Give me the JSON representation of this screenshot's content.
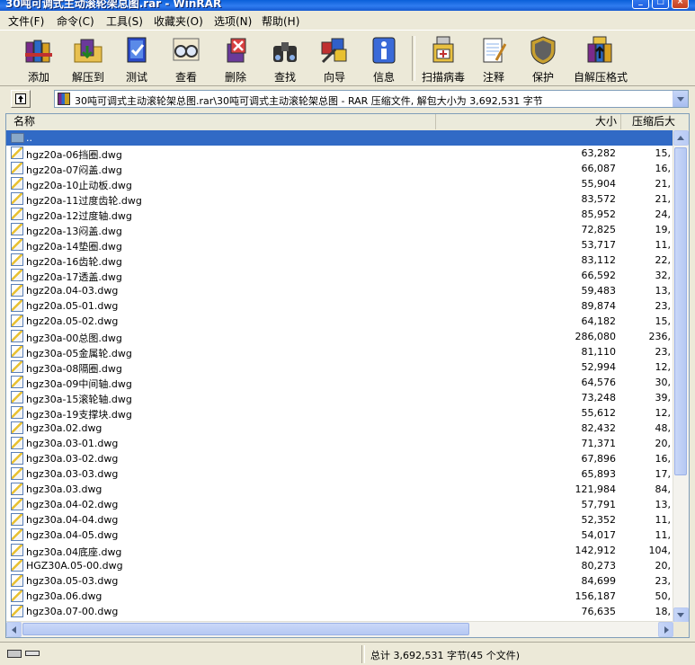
{
  "window": {
    "title": "30吨可调式主动滚轮架总图.rar - WinRAR",
    "minimize_glyph": "_",
    "maximize_glyph": "□",
    "close_glyph": "×"
  },
  "menu": [
    {
      "label": "文件(F)"
    },
    {
      "label": "命令(C)"
    },
    {
      "label": "工具(S)"
    },
    {
      "label": "收藏夹(O)"
    },
    {
      "label": "选项(N)"
    },
    {
      "label": "帮助(H)"
    }
  ],
  "toolbar": [
    {
      "label": "添加",
      "icon": "books-add-icon"
    },
    {
      "label": "解压到",
      "icon": "folder-extract-icon"
    },
    {
      "label": "测试",
      "icon": "book-test-icon"
    },
    {
      "label": "查看",
      "icon": "glasses-view-icon"
    },
    {
      "label": "删除",
      "icon": "book-delete-icon"
    },
    {
      "label": "查找",
      "icon": "binoculars-find-icon"
    },
    {
      "label": "向导",
      "icon": "wand-wizard-icon"
    },
    {
      "label": "信息",
      "icon": "info-icon"
    },
    {
      "label": "扫描病毒",
      "icon": "virus-scan-icon"
    },
    {
      "label": "注释",
      "icon": "notepad-comment-icon"
    },
    {
      "label": "保护",
      "icon": "shield-protect-icon"
    },
    {
      "label": "自解压格式",
      "icon": "sfx-icon"
    }
  ],
  "address": {
    "path": "30吨可调式主动滚轮架总图.rar\\30吨可调式主动滚轮架总图 - RAR 压缩文件, 解包大小为 3,692,531 字节"
  },
  "columns": {
    "name": "名称",
    "size": "大小",
    "packed": "压缩后大"
  },
  "files": [
    {
      "name": "..",
      "size": "",
      "packed": "",
      "folder": true
    },
    {
      "name": "hgz20a-06挡圈.dwg",
      "size": "63,282",
      "packed": "15,"
    },
    {
      "name": "hgz20a-07闷盖.dwg",
      "size": "66,087",
      "packed": "16,"
    },
    {
      "name": "hgz20a-10止动板.dwg",
      "size": "55,904",
      "packed": "21,"
    },
    {
      "name": "hgz20a-11过度齿轮.dwg",
      "size": "83,572",
      "packed": "21,"
    },
    {
      "name": "hgz20a-12过度轴.dwg",
      "size": "85,952",
      "packed": "24,"
    },
    {
      "name": "hgz20a-13闷盖.dwg",
      "size": "72,825",
      "packed": "19,"
    },
    {
      "name": "hgz20a-14垫圈.dwg",
      "size": "53,717",
      "packed": "11,"
    },
    {
      "name": "hgz20a-16齿轮.dwg",
      "size": "83,112",
      "packed": "22,"
    },
    {
      "name": "hgz20a-17透盖.dwg",
      "size": "66,592",
      "packed": "32,"
    },
    {
      "name": "hgz20a.04-03.dwg",
      "size": "59,483",
      "packed": "13,"
    },
    {
      "name": "hgz20a.05-01.dwg",
      "size": "89,874",
      "packed": "23,"
    },
    {
      "name": "hgz20a.05-02.dwg",
      "size": "64,182",
      "packed": "15,"
    },
    {
      "name": "hgz30a-00总图.dwg",
      "size": "286,080",
      "packed": "236,"
    },
    {
      "name": "hgz30a-05金属轮.dwg",
      "size": "81,110",
      "packed": "23,"
    },
    {
      "name": "hgz30a-08隔圈.dwg",
      "size": "52,994",
      "packed": "12,"
    },
    {
      "name": "hgz30a-09中间轴.dwg",
      "size": "64,576",
      "packed": "30,"
    },
    {
      "name": "hgz30a-15滚轮轴.dwg",
      "size": "73,248",
      "packed": "39,"
    },
    {
      "name": "hgz30a-19支撑块.dwg",
      "size": "55,612",
      "packed": "12,"
    },
    {
      "name": "hgz30a.02.dwg",
      "size": "82,432",
      "packed": "48,"
    },
    {
      "name": "hgz30a.03-01.dwg",
      "size": "71,371",
      "packed": "20,"
    },
    {
      "name": "hgz30a.03-02.dwg",
      "size": "67,896",
      "packed": "16,"
    },
    {
      "name": "hgz30a.03-03.dwg",
      "size": "65,893",
      "packed": "17,"
    },
    {
      "name": "hgz30a.03.dwg",
      "size": "121,984",
      "packed": "84,"
    },
    {
      "name": "hgz30a.04-02.dwg",
      "size": "57,791",
      "packed": "13,"
    },
    {
      "name": "hgz30a.04-04.dwg",
      "size": "52,352",
      "packed": "11,"
    },
    {
      "name": "hgz30a.04-05.dwg",
      "size": "54,017",
      "packed": "11,"
    },
    {
      "name": "hgz30a.04底座.dwg",
      "size": "142,912",
      "packed": "104,"
    },
    {
      "name": "HGZ30A.05-00.dwg",
      "size": "80,273",
      "packed": "20,"
    },
    {
      "name": "hgz30a.05-03.dwg",
      "size": "84,699",
      "packed": "23,"
    },
    {
      "name": "hgz30a.06.dwg",
      "size": "156,187",
      "packed": "50,"
    },
    {
      "name": "hgz30a.07-00.dwg",
      "size": "76,635",
      "packed": "18,"
    }
  ],
  "status": {
    "summary": "总计 3,692,531 字节(45 个文件)"
  }
}
